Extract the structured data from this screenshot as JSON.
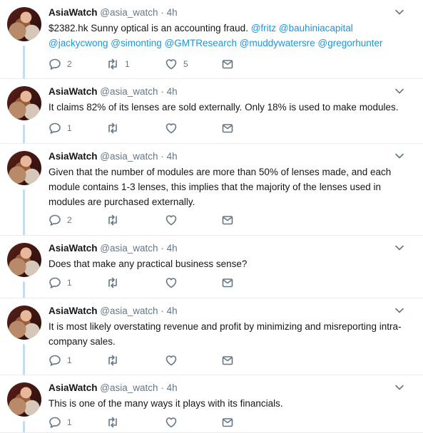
{
  "author": {
    "name": "AsiaWatch",
    "handle": "@asia_watch",
    "separator": "·"
  },
  "tweets": [
    {
      "time": "4h",
      "text_parts": [
        "$2382.hk Sunny optical is an accounting fraud.  ",
        "@fritz",
        " ",
        "@bauhiniacapital",
        " ",
        "@jackycwong",
        " ",
        "@simonting",
        " ",
        "@GMTResearch",
        " ",
        "@muddywatersre",
        " ",
        "@gregorhunter"
      ],
      "replies": "2",
      "retweets": "1",
      "likes": "5"
    },
    {
      "time": "4h",
      "text": "It claims 82% of its lenses are sold externally. Only 18% is used to make modules.",
      "replies": "1",
      "retweets": "",
      "likes": ""
    },
    {
      "time": "4h",
      "text": "Given that the number of modules are more than 50% of lenses made, and each module contains 1-3 lenses, this implies that the majority of the lenses used in modules are purchased externally.",
      "replies": "2",
      "retweets": "",
      "likes": ""
    },
    {
      "time": "4h",
      "text": "Does that make any practical business sense?",
      "replies": "1",
      "retweets": "",
      "likes": ""
    },
    {
      "time": "4h",
      "text": "It is most likely overstating revenue and profit by minimizing and misreporting intra-company sales.",
      "replies": "1",
      "retweets": "",
      "likes": ""
    },
    {
      "time": "4h",
      "text": "This is one of the many ways it plays with its financials.",
      "replies": "1",
      "retweets": "",
      "likes": ""
    }
  ],
  "colors": {
    "text": "#14171a",
    "muted": "#657786",
    "link": "#1b95e0",
    "thread_line": "#c3dcee",
    "divider": "#e6ecf0"
  }
}
